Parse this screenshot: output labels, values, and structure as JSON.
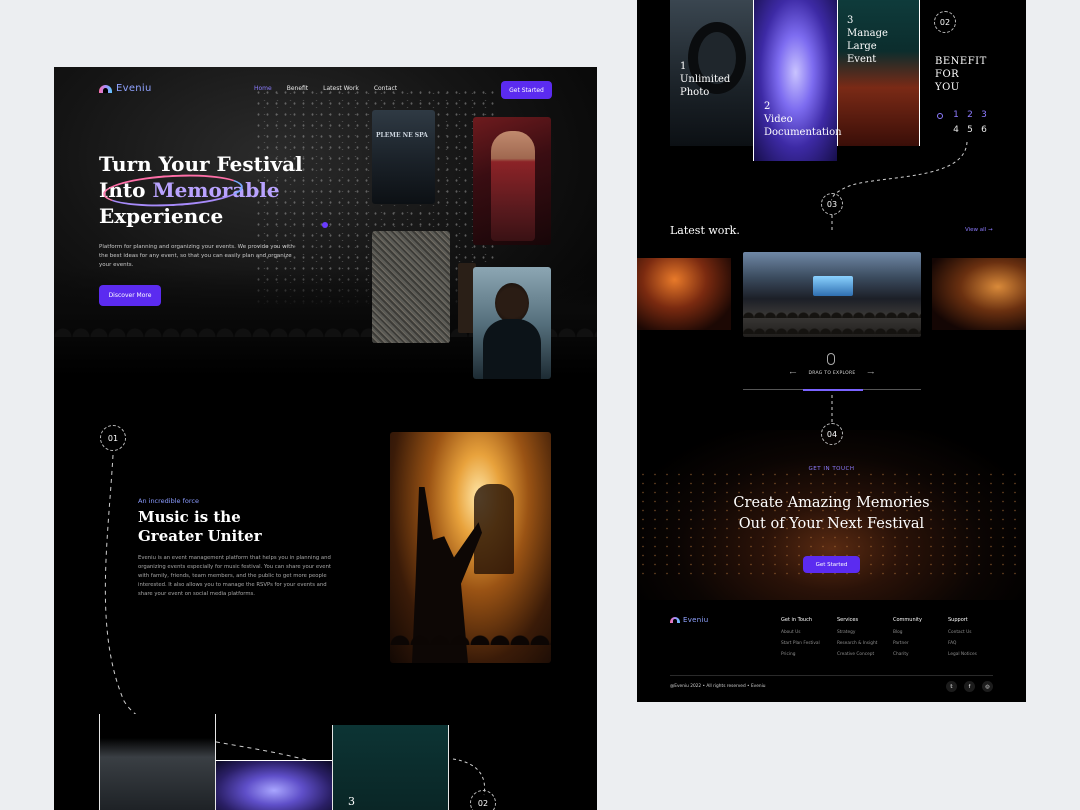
{
  "left": {
    "brand": "Eveniu",
    "nav": [
      "Home",
      "Benefit",
      "Latest Work",
      "Contact"
    ],
    "cta": "Get Started",
    "hero": {
      "line1": "Turn Your Festival",
      "line2_prefix": "Into ",
      "line2_highlight": "Memorable",
      "line3": "Experience",
      "desc": "Platform for planning and organizing your events. We provide you with the best ideas for any event, so that you can easily plan and organize your events.",
      "button": "Discover More",
      "sign_text": "PLEME NE SPA"
    },
    "step1": "01",
    "music": {
      "sub": "An incredible force",
      "title_line1": "Music is the",
      "title_line2": "Greater Uniter",
      "desc": "Eveniu is an event management platform that helps you in planning and organizing events especially for music festival. You can share your event with family, friends, team members, and the public to get more people interested. It also allows you to manage the RSVPs for your events and share your event on social media platforms."
    },
    "strip_number": "3",
    "step2": "02"
  },
  "right": {
    "benefits": [
      {
        "num": "1",
        "line1": "Unlimited",
        "line2": "Photo"
      },
      {
        "num": "2",
        "line1": "Video",
        "line2": "Documentation"
      },
      {
        "num": "3",
        "line1": "Manage",
        "line2": "Large",
        "line3": "Event"
      }
    ],
    "step2": "02",
    "benefit_title": [
      "BENEFIT",
      "FOR",
      "YOU"
    ],
    "pager_row1": [
      "1",
      "2",
      "3"
    ],
    "pager_row2": [
      "4",
      "5",
      "6"
    ],
    "step3": "03",
    "latest_title": "Latest work.",
    "view_all": "View all",
    "drag_label": "DRAG TO EXPLORE",
    "step4": "04",
    "cta_sub": "GET IN TOUCH",
    "cta_line1": "Create Amazing Memories",
    "cta_line2": "Out of  Your Next Festival",
    "cta_button": "Get Started",
    "footer": {
      "brand": "Eveniu",
      "columns": [
        {
          "title": "Get in Touch",
          "items": [
            "About Us",
            "Start Plan Festival",
            "Pricing"
          ]
        },
        {
          "title": "Services",
          "items": [
            "Strategy",
            "Research & Insight",
            "Creative Concept"
          ]
        },
        {
          "title": "Community",
          "items": [
            "Blog",
            "Partner",
            "Charity"
          ]
        },
        {
          "title": "Support",
          "items": [
            "Contact Us",
            "FAQ",
            "Legal Notices"
          ]
        }
      ],
      "copyright": "@Eveniu 2022 • All rights reserved • Eveniu",
      "social": [
        "twitter-icon",
        "facebook-icon",
        "instagram-icon"
      ]
    }
  },
  "colors": {
    "accent": "#5b2bf0",
    "accent_text": "#8d7bff",
    "background": "#000000",
    "page": "#eceef1"
  }
}
